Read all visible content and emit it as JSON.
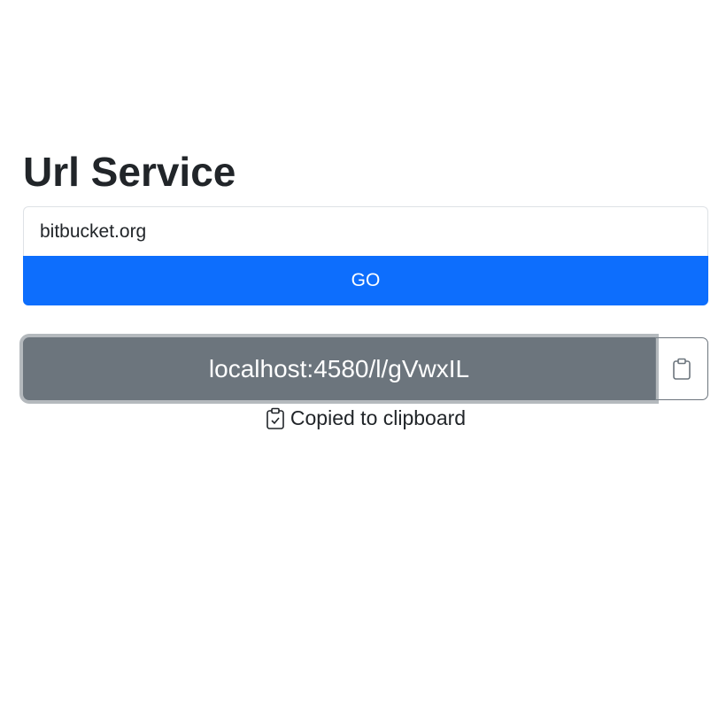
{
  "header": {
    "title": "Url Service"
  },
  "form": {
    "url_value": "bitbucket.org",
    "go_label": "GO"
  },
  "result": {
    "short_url": "localhost:4580/l/gVwxIL",
    "copy_icon": "clipboard-icon",
    "status_icon": "clipboard-check-icon",
    "status_text": "Copied to clipboard"
  },
  "colors": {
    "primary": "#0d6efd",
    "secondary": "#6c757d",
    "text": "#212529"
  }
}
